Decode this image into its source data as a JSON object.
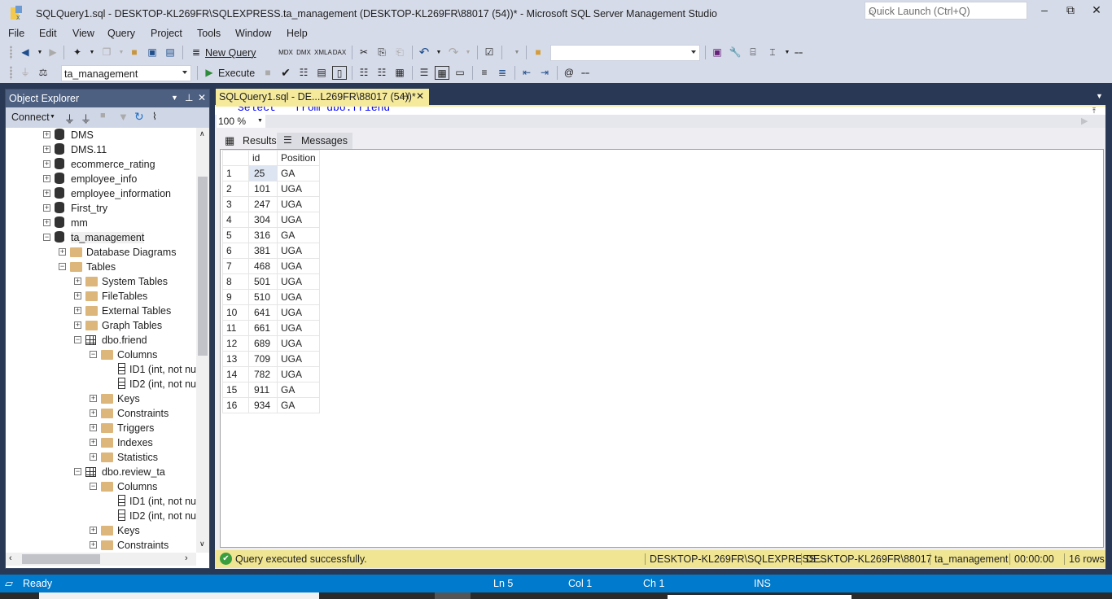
{
  "window": {
    "title": "SQLQuery1.sql - DESKTOP-KL269FR\\SQLEXPRESS.ta_management (DESKTOP-KL269FR\\88017 (54))* - Microsoft SQL Server Management Studio",
    "quick_launch_placeholder": "Quick Launch (Ctrl+Q)"
  },
  "menu": [
    "File",
    "Edit",
    "View",
    "Query",
    "Project",
    "Tools",
    "Window",
    "Help"
  ],
  "toolbar": {
    "new_query_label": "New Query",
    "execute_label": "Execute",
    "database_selected": "ta_management",
    "solution_combo_value": ""
  },
  "object_explorer": {
    "title": "Object Explorer",
    "connect_label": "Connect",
    "nodes": [
      {
        "label": "DMS",
        "type": "database",
        "level": 0,
        "state": "collapsed"
      },
      {
        "label": "DMS.11",
        "type": "database",
        "level": 0,
        "state": "collapsed"
      },
      {
        "label": "ecommerce_rating",
        "type": "database",
        "level": 0,
        "state": "collapsed"
      },
      {
        "label": "employee_info",
        "type": "database",
        "level": 0,
        "state": "collapsed"
      },
      {
        "label": "employee_information",
        "type": "database",
        "level": 0,
        "state": "collapsed"
      },
      {
        "label": "First_try",
        "type": "database",
        "level": 0,
        "state": "collapsed"
      },
      {
        "label": "mm",
        "type": "database",
        "level": 0,
        "state": "collapsed"
      },
      {
        "label": "ta_management",
        "type": "database",
        "level": 0,
        "state": "expanded"
      },
      {
        "label": "Database Diagrams",
        "type": "folder",
        "level": 1,
        "state": "collapsed"
      },
      {
        "label": "Tables",
        "type": "folder",
        "level": 1,
        "state": "expanded"
      },
      {
        "label": "System Tables",
        "type": "folder",
        "level": 2,
        "state": "collapsed"
      },
      {
        "label": "FileTables",
        "type": "folder",
        "level": 2,
        "state": "collapsed"
      },
      {
        "label": "External Tables",
        "type": "folder",
        "level": 2,
        "state": "collapsed"
      },
      {
        "label": "Graph Tables",
        "type": "folder",
        "level": 2,
        "state": "collapsed"
      },
      {
        "label": "dbo.friend",
        "type": "table",
        "level": 2,
        "state": "expanded"
      },
      {
        "label": "Columns",
        "type": "folder",
        "level": 3,
        "state": "expanded"
      },
      {
        "label": "ID1 (int, not nu",
        "type": "column",
        "level": 4,
        "state": "leaf"
      },
      {
        "label": "ID2 (int, not nu",
        "type": "column",
        "level": 4,
        "state": "leaf"
      },
      {
        "label": "Keys",
        "type": "folder",
        "level": 3,
        "state": "collapsed"
      },
      {
        "label": "Constraints",
        "type": "folder",
        "level": 3,
        "state": "collapsed"
      },
      {
        "label": "Triggers",
        "type": "folder",
        "level": 3,
        "state": "collapsed"
      },
      {
        "label": "Indexes",
        "type": "folder",
        "level": 3,
        "state": "collapsed"
      },
      {
        "label": "Statistics",
        "type": "folder",
        "level": 3,
        "state": "collapsed"
      },
      {
        "label": "dbo.review_ta",
        "type": "table",
        "level": 2,
        "state": "expanded"
      },
      {
        "label": "Columns",
        "type": "folder",
        "level": 3,
        "state": "expanded"
      },
      {
        "label": "ID1 (int, not nu",
        "type": "column",
        "level": 4,
        "state": "leaf"
      },
      {
        "label": "ID2 (int, not nu",
        "type": "column",
        "level": 4,
        "state": "leaf"
      },
      {
        "label": "Keys",
        "type": "folder",
        "level": 3,
        "state": "collapsed"
      },
      {
        "label": "Constraints",
        "type": "folder",
        "level": 3,
        "state": "collapsed"
      }
    ]
  },
  "document": {
    "tab_label": "SQLQuery1.sql - DE...L269FR\\88017 (54))*",
    "editor_visible_code": "Select * from dbo.friend",
    "zoom": "100 %",
    "result_tabs": [
      "Results",
      "Messages"
    ],
    "grid": {
      "columns": [
        "",
        "id",
        "Position"
      ],
      "rows": [
        [
          "1",
          "25",
          "GA"
        ],
        [
          "2",
          "101",
          "UGA"
        ],
        [
          "3",
          "247",
          "UGA"
        ],
        [
          "4",
          "304",
          "UGA"
        ],
        [
          "5",
          "316",
          "GA"
        ],
        [
          "6",
          "381",
          "UGA"
        ],
        [
          "7",
          "468",
          "UGA"
        ],
        [
          "8",
          "501",
          "UGA"
        ],
        [
          "9",
          "510",
          "UGA"
        ],
        [
          "10",
          "641",
          "UGA"
        ],
        [
          "11",
          "661",
          "UGA"
        ],
        [
          "12",
          "689",
          "UGA"
        ],
        [
          "13",
          "709",
          "UGA"
        ],
        [
          "14",
          "782",
          "UGA"
        ],
        [
          "15",
          "911",
          "GA"
        ],
        [
          "16",
          "934",
          "GA"
        ]
      ]
    },
    "query_status": {
      "message": "Query executed successfully.",
      "server": "DESKTOP-KL269FR\\SQLEXPRESS ...",
      "user": "DESKTOP-KL269FR\\88017 ...",
      "database": "ta_management",
      "elapsed": "00:00:00",
      "rows": "16 rows"
    }
  },
  "statusbar": {
    "state": "Ready",
    "line": "Ln 5",
    "col": "Col 1",
    "ch": "Ch 1",
    "mode": "INS"
  }
}
